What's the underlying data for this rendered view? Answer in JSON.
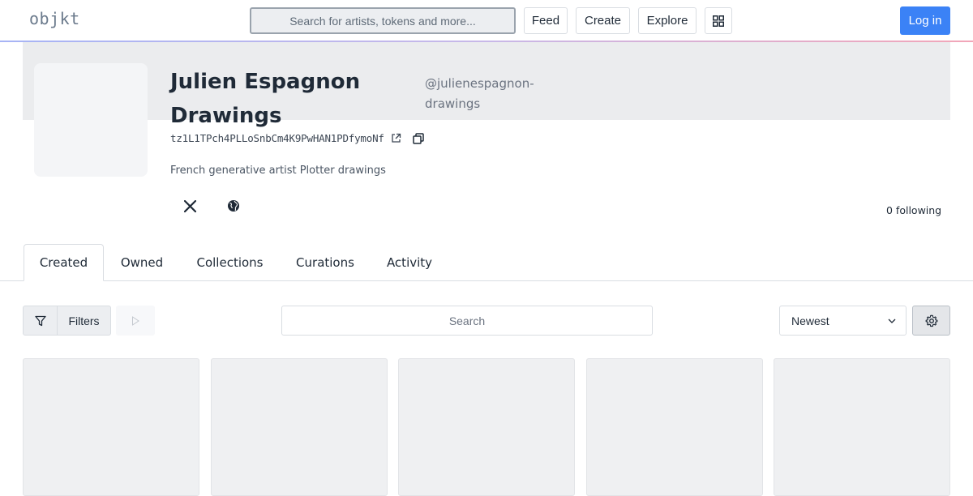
{
  "header": {
    "logo": "objkt",
    "search_placeholder": "Search for artists, tokens and more...",
    "nav": [
      {
        "label": "Feed"
      },
      {
        "label": "Create"
      },
      {
        "label": "Explore"
      }
    ],
    "login_label": "Log in"
  },
  "profile": {
    "name": "Julien Espagnon Drawings",
    "handle": "@julienespagnon-drawings",
    "address": "tz1L1TPch4PLLoSnbCm4K9PwHAN1PDfymoNf",
    "bio": "French generative artist Plotter drawings",
    "following": "0 following",
    "socials": [
      {
        "icon": "x-twitter-icon"
      },
      {
        "icon": "globe-icon"
      }
    ]
  },
  "tabs": [
    {
      "label": "Created",
      "active": true
    },
    {
      "label": "Owned",
      "active": false
    },
    {
      "label": "Collections",
      "active": false
    },
    {
      "label": "Curations",
      "active": false
    },
    {
      "label": "Activity",
      "active": false
    }
  ],
  "toolbar": {
    "filters_label": "Filters",
    "search_placeholder": "Search",
    "sort_value": "Newest"
  },
  "colors": {
    "accent": "#3b82f6",
    "banner": "#ebecee",
    "card_placeholder": "#eff0f2"
  }
}
